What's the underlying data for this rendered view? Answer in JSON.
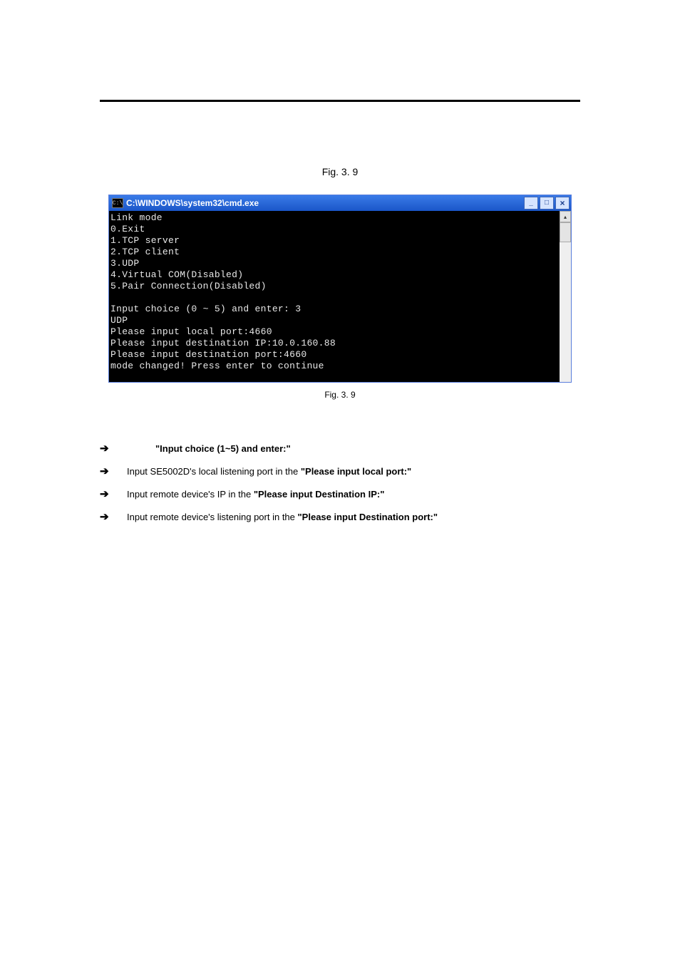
{
  "fig_caption_top": "Fig. 3. 9",
  "fig_caption_bottom": "Fig. 3. 9",
  "console": {
    "icon_text": "C:\\",
    "title": "C:\\WINDOWS\\system32\\cmd.exe",
    "min_glyph": "_",
    "max_glyph": "□",
    "close_glyph": "×",
    "scroll_up_glyph": "▴",
    "lines": [
      "Link mode",
      "0.Exit",
      "1.TCP server",
      "2.TCP client",
      "3.UDP",
      "4.Virtual COM(Disabled)",
      "5.Pair Connection(Disabled)",
      "",
      "Input choice (0 ~ 5) and enter: 3",
      "UDP",
      "Please input local port:4660",
      "Please input destination IP:10.0.160.88",
      "Please input destination port:4660",
      "mode changed! Press enter to continue"
    ]
  },
  "instructions": {
    "arrow_glyph": "➔",
    "i0_bold": "\"Input choice (1~5) and enter:\"",
    "i1_pre": "Input SE5002D's local listening port in the ",
    "i1_bold": "\"Please input local port:\"",
    "i2_pre": "Input remote device's IP in the ",
    "i2_bold": "\"Please input Destination IP:\"",
    "i3_pre": "Input remote device's listening port in the ",
    "i3_bold": "\"Please input Destination port:\""
  }
}
